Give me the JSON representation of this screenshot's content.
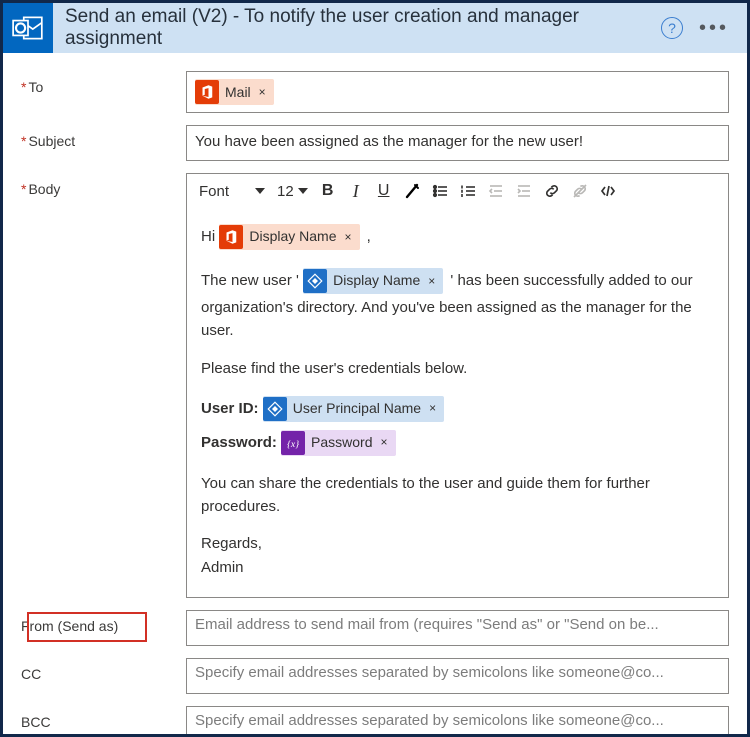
{
  "header": {
    "title": "Send an email (V2) - To notify the user creation and manager assignment"
  },
  "labels": {
    "to": "To",
    "subject": "Subject",
    "body": "Body",
    "from": "From (Send as)",
    "cc": "CC",
    "bcc": "BCC"
  },
  "fields": {
    "subject_value": "You have been assigned as the manager for the new user!",
    "from_placeholder": "Email address to send mail from (requires \"Send as\" or \"Send on be...",
    "cc_placeholder": "Specify email addresses separated by semicolons like someone@co...",
    "bcc_placeholder": "Specify email addresses separated by semicolons like someone@co..."
  },
  "tokens": {
    "mail": "Mail",
    "display_name_o365": "Display Name",
    "display_name_aad": "Display Name",
    "upn": "User Principal Name",
    "password": "Password"
  },
  "toolbar": {
    "font": "Font",
    "size": "12"
  },
  "body": {
    "hi": "Hi",
    "comma": ",",
    "line2a": "The new user '",
    "line2b": "' has been successfully  added to our organization's directory. And you've been assigned as the manager for the user.",
    "line3": "Please find the user's credentials below.",
    "userid_lbl": "User ID:",
    "pwd_lbl": "Password:",
    "line4": "You can share the credentials to the user and guide them for further procedures.",
    "regards": "Regards,",
    "admin": "Admin"
  },
  "x": "×"
}
